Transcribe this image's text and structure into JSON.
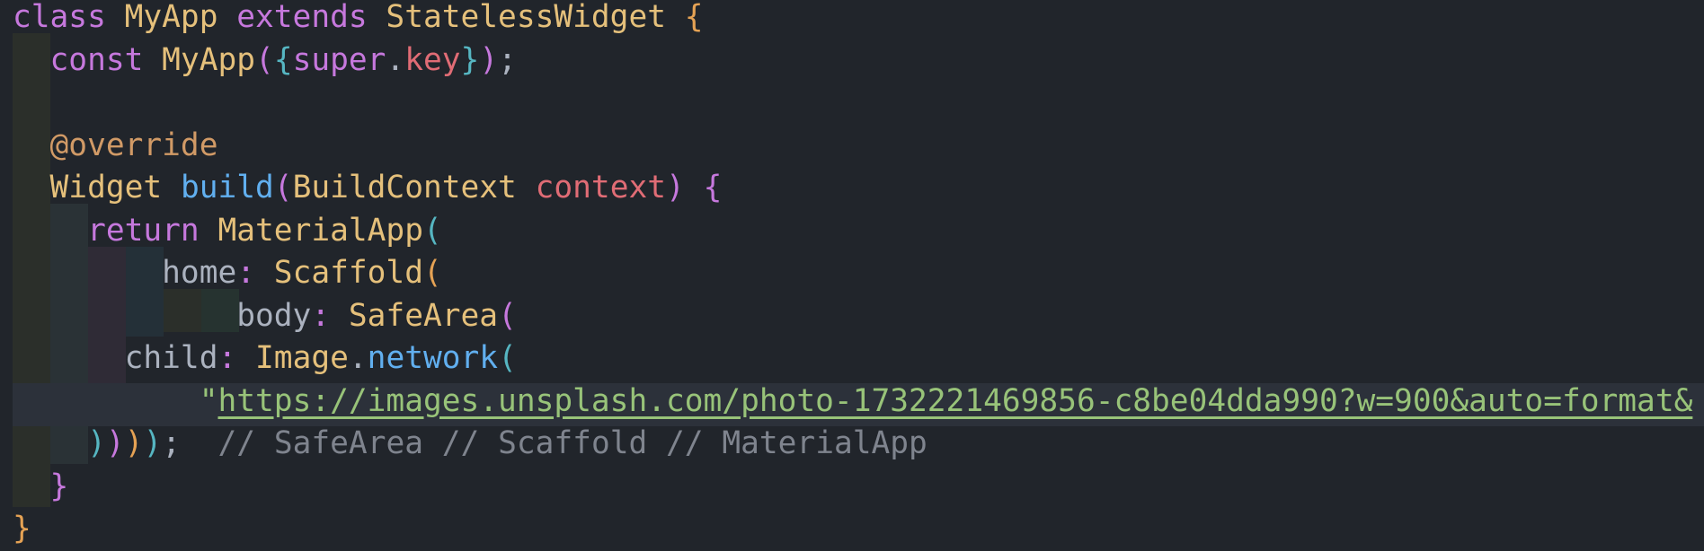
{
  "editor": {
    "language": "dart",
    "colors": {
      "background": "#21252b",
      "keyword": "#c678dd",
      "class": "#e5c07b",
      "string": "#98c379",
      "comment": "#7f848e",
      "function": "#61afef",
      "parameter": "#e06c75"
    },
    "lines": [
      {
        "id": 1,
        "tokens": [
          {
            "t": "class ",
            "c": "kw"
          },
          {
            "t": "MyApp ",
            "c": "cls"
          },
          {
            "t": "extends ",
            "c": "kw"
          },
          {
            "t": "StatelessWidget ",
            "c": "cls"
          },
          {
            "t": "{",
            "c": "brace"
          }
        ]
      },
      {
        "id": 2,
        "tokens": [
          {
            "t": "  const ",
            "c": "kw"
          },
          {
            "t": "MyApp",
            "c": "cls"
          },
          {
            "t": "(",
            "c": "par"
          },
          {
            "t": "{",
            "c": "par2"
          },
          {
            "t": "super",
            "c": "kw"
          },
          {
            "t": ".",
            "c": "named"
          },
          {
            "t": "key",
            "c": "field"
          },
          {
            "t": "}",
            "c": "par2"
          },
          {
            "t": ")",
            "c": "par"
          },
          {
            "t": ";",
            "c": "named"
          }
        ]
      },
      {
        "id": 3,
        "tokens": []
      },
      {
        "id": 4,
        "tokens": [
          {
            "t": "  @override",
            "c": "ann"
          }
        ]
      },
      {
        "id": 5,
        "tokens": [
          {
            "t": "  Widget ",
            "c": "cls"
          },
          {
            "t": "build",
            "c": "fn"
          },
          {
            "t": "(",
            "c": "par"
          },
          {
            "t": "BuildContext ",
            "c": "cls"
          },
          {
            "t": "context",
            "c": "param"
          },
          {
            "t": ") ",
            "c": "par"
          },
          {
            "t": "{",
            "c": "par"
          }
        ]
      },
      {
        "id": 6,
        "tokens": [
          {
            "t": "    return ",
            "c": "kw"
          },
          {
            "t": "MaterialApp",
            "c": "cls"
          },
          {
            "t": "(",
            "c": "par2"
          }
        ]
      },
      {
        "id": 7,
        "tokens": [
          {
            "t": "        home",
            "c": "named"
          },
          {
            "t": ": ",
            "c": "kw"
          },
          {
            "t": "Scaffold",
            "c": "cls"
          },
          {
            "t": "(",
            "c": "brace"
          }
        ]
      },
      {
        "id": 8,
        "tokens": [
          {
            "t": "            body",
            "c": "named"
          },
          {
            "t": ": ",
            "c": "kw"
          },
          {
            "t": "SafeArea",
            "c": "cls"
          },
          {
            "t": "(",
            "c": "par"
          }
        ]
      },
      {
        "id": 9,
        "tokens": [
          {
            "t": "      child",
            "c": "named"
          },
          {
            "t": ": ",
            "c": "kw"
          },
          {
            "t": "Image",
            "c": "cls"
          },
          {
            "t": ".",
            "c": "named"
          },
          {
            "t": "network",
            "c": "fn"
          },
          {
            "t": "(",
            "c": "par2"
          }
        ]
      },
      {
        "id": 10,
        "tokens": [
          {
            "t": "          \"",
            "c": "str"
          },
          {
            "t": "https://images.unsplash.com/photo-1732221469856-c8be04dda990?w=900&auto=format&",
            "c": "link"
          }
        ]
      },
      {
        "id": 11,
        "tokens": [
          {
            "t": "    ",
            "c": "named"
          },
          {
            "t": ")",
            "c": "par2"
          },
          {
            "t": ")",
            "c": "par"
          },
          {
            "t": ")",
            "c": "brace"
          },
          {
            "t": ")",
            "c": "par2"
          },
          {
            "t": ";  ",
            "c": "named"
          },
          {
            "t": "// SafeArea // Scaffold // MaterialApp",
            "c": "cmt"
          }
        ]
      },
      {
        "id": 12,
        "tokens": [
          {
            "t": "  }",
            "c": "par"
          }
        ]
      },
      {
        "id": 13,
        "tokens": [
          {
            "t": "}",
            "c": "brace"
          }
        ]
      }
    ]
  }
}
